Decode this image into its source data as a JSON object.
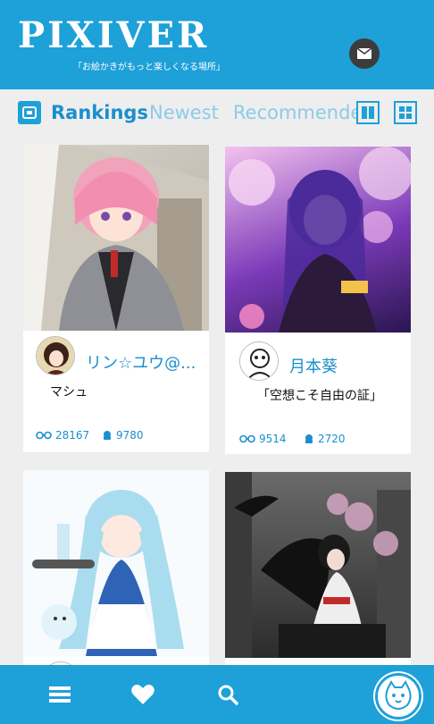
{
  "header": {
    "logo_title": "PIXIVER",
    "logo_subtitle": "「お絵かきがもっと楽しくなる場所」",
    "mail_icon": "mail-icon"
  },
  "tabs": {
    "rankings": "Rankings",
    "newest": "Newest",
    "recommended": "Recommended",
    "active": "Rankings"
  },
  "cards": [
    {
      "author": "リン☆ユウ@...",
      "caption": "マシュ",
      "views": "28167",
      "favorites": "9780"
    },
    {
      "author": "月本葵",
      "caption": "「空想こそ自由の証」",
      "views": "9514",
      "favorites": "2720"
    },
    {
      "author": "",
      "caption": "",
      "views": "",
      "favorites": ""
    },
    {
      "author": "",
      "caption": "",
      "views": "",
      "favorites": ""
    }
  ],
  "bottom_nav": {
    "items": [
      "menu-icon",
      "heart-icon",
      "search-icon",
      "cat-avatar-icon"
    ]
  },
  "colors": {
    "brand": "#1ea0d8",
    "accent_text": "#1b8fcd",
    "inactive_tab": "#8ccbe8",
    "background": "#eeeeee"
  }
}
